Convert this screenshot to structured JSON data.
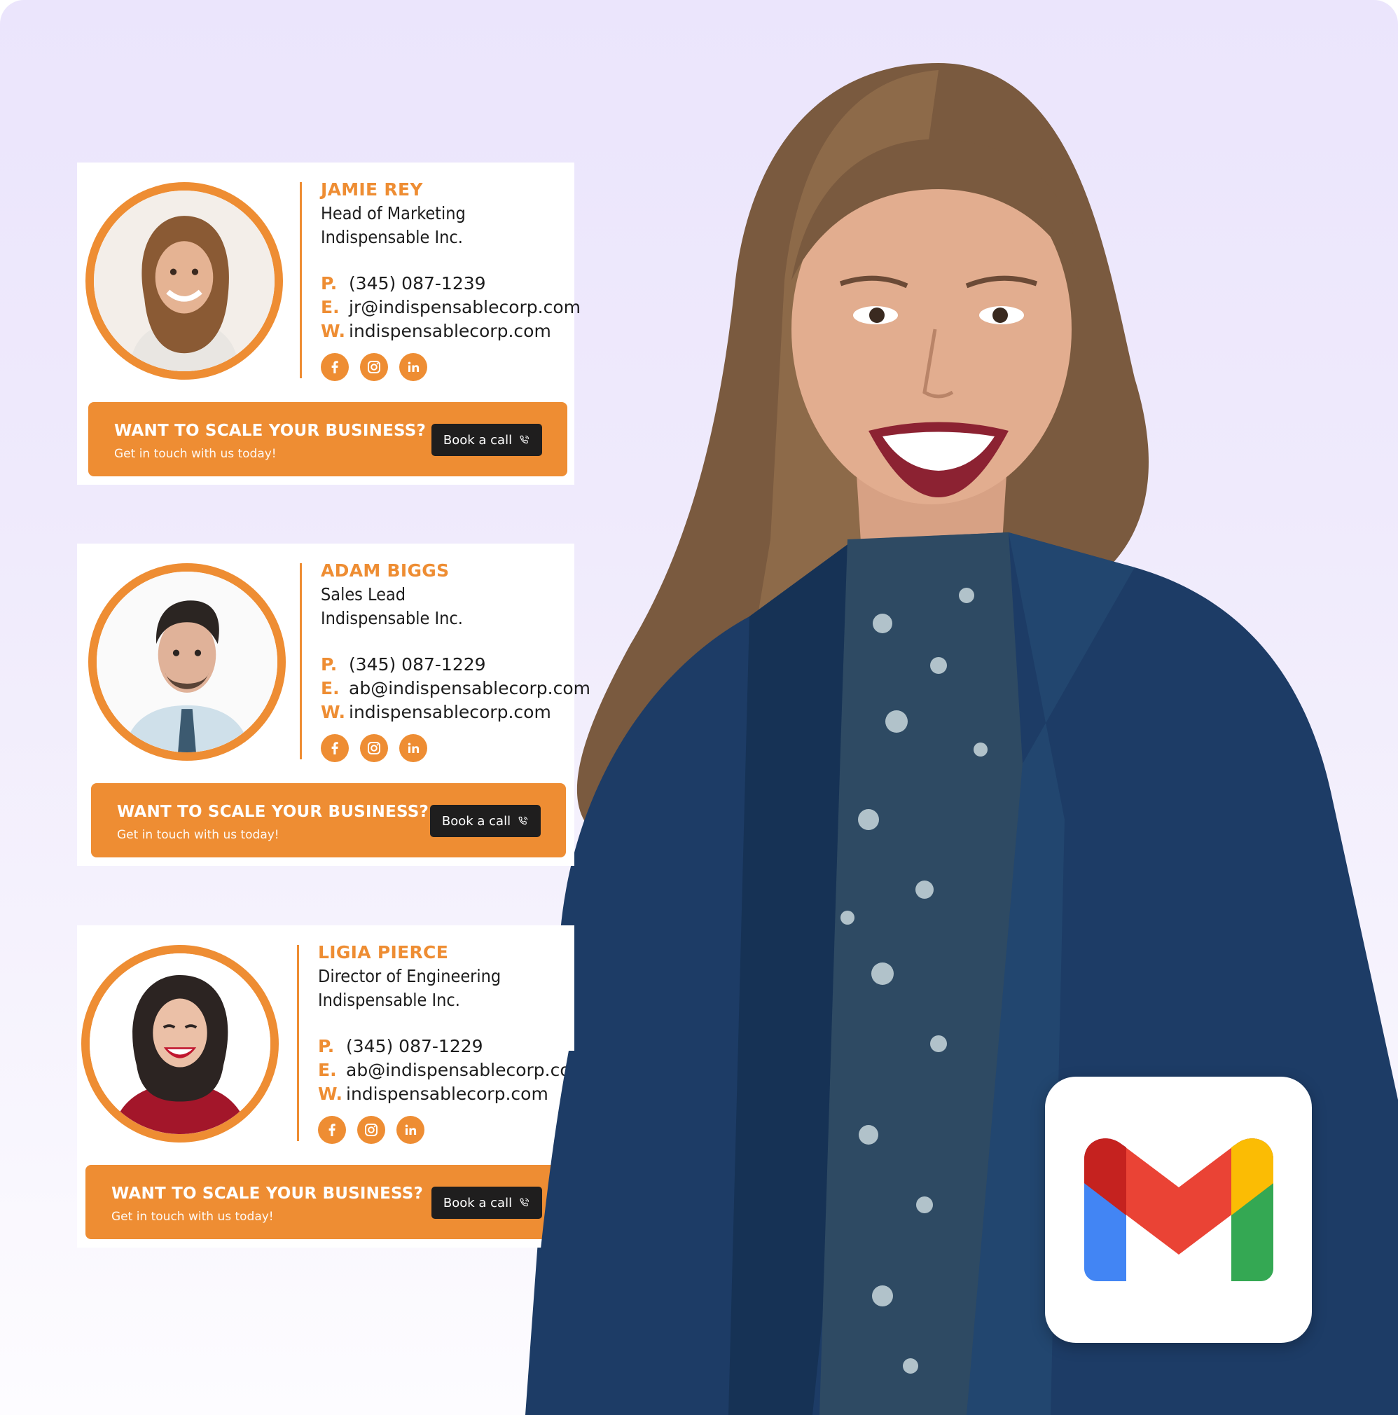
{
  "brand": {
    "accent": "#ee8d33",
    "cta_button_bg": "#1f1e1e",
    "background_top": "#ebe5fc",
    "background_bottom": "#fdfcff"
  },
  "cards": [
    {
      "name": "JAMIE REY",
      "title": "Head of Marketing",
      "company": "Indispensable Inc.",
      "phone_key": "P.",
      "phone": "(345) 087-1239",
      "email_key": "E.",
      "email": "jr@indispensablecorp.com",
      "web_key": "W.",
      "web": "indispensablecorp.com",
      "socials": [
        "facebook-icon",
        "instagram-icon",
        "linkedin-icon"
      ],
      "cta": {
        "title": "WANT TO SCALE YOUR BUSINESS?",
        "subtitle": "Get in touch with us today!",
        "button": "Book a call",
        "button_icon": "phone-call-icon"
      }
    },
    {
      "name": "ADAM BIGGS",
      "title": "Sales Lead",
      "company": "Indispensable Inc.",
      "phone_key": "P.",
      "phone": "(345) 087-1229",
      "email_key": "E.",
      "email": "ab@indispensablecorp.com",
      "web_key": "W.",
      "web": "indispensablecorp.com",
      "socials": [
        "facebook-icon",
        "instagram-icon",
        "linkedin-icon"
      ],
      "cta": {
        "title": "WANT TO SCALE YOUR BUSINESS?",
        "subtitle": "Get in touch with us today!",
        "button": "Book a call",
        "button_icon": "phone-call-icon"
      }
    },
    {
      "name": "LIGIA PIERCE",
      "title": "Director of Engineering",
      "company": "Indispensable Inc.",
      "phone_key": "P.",
      "phone": "(345) 087-1229",
      "email_key": "E.",
      "email": "ab@indispensablecorp.com",
      "web_key": "W.",
      "web": "indispensablecorp.com",
      "socials": [
        "facebook-icon",
        "instagram-icon",
        "linkedin-icon"
      ],
      "cta": {
        "title": "WANT TO SCALE YOUR BUSINESS?",
        "subtitle": "Get in touch with us today!",
        "button": "Book a call",
        "button_icon": "phone-call-icon"
      }
    }
  ],
  "logo": {
    "name": "gmail-logo",
    "colors": {
      "red": "#ea4335",
      "dark_red": "#c5221f",
      "blue": "#4285f4",
      "green": "#34a853",
      "yellow": "#fbbc04"
    }
  },
  "hero": {
    "subject": "smiling woman in navy blazer"
  }
}
